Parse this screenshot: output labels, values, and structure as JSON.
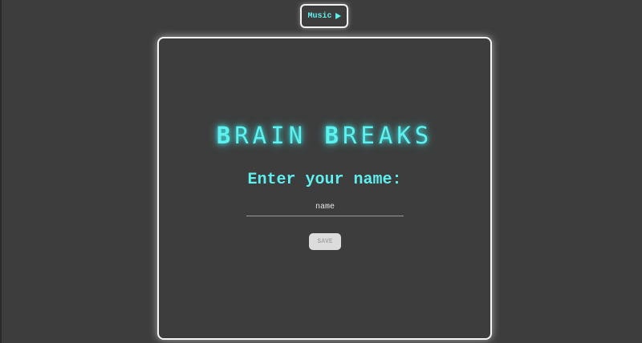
{
  "header": {
    "music_label": "Music",
    "music_icon": "play-icon"
  },
  "card": {
    "title_parts": [
      "B",
      "RAIN ",
      "B",
      "REAKS"
    ],
    "prompt": "Enter your name:",
    "name_input": {
      "value": "",
      "placeholder": "name"
    },
    "save_label": "SAVE"
  },
  "colors": {
    "background": "#3d3d3d",
    "accent": "#5ef0ee",
    "border": "#f5f5f5",
    "save_button": "#dcdcdc"
  }
}
